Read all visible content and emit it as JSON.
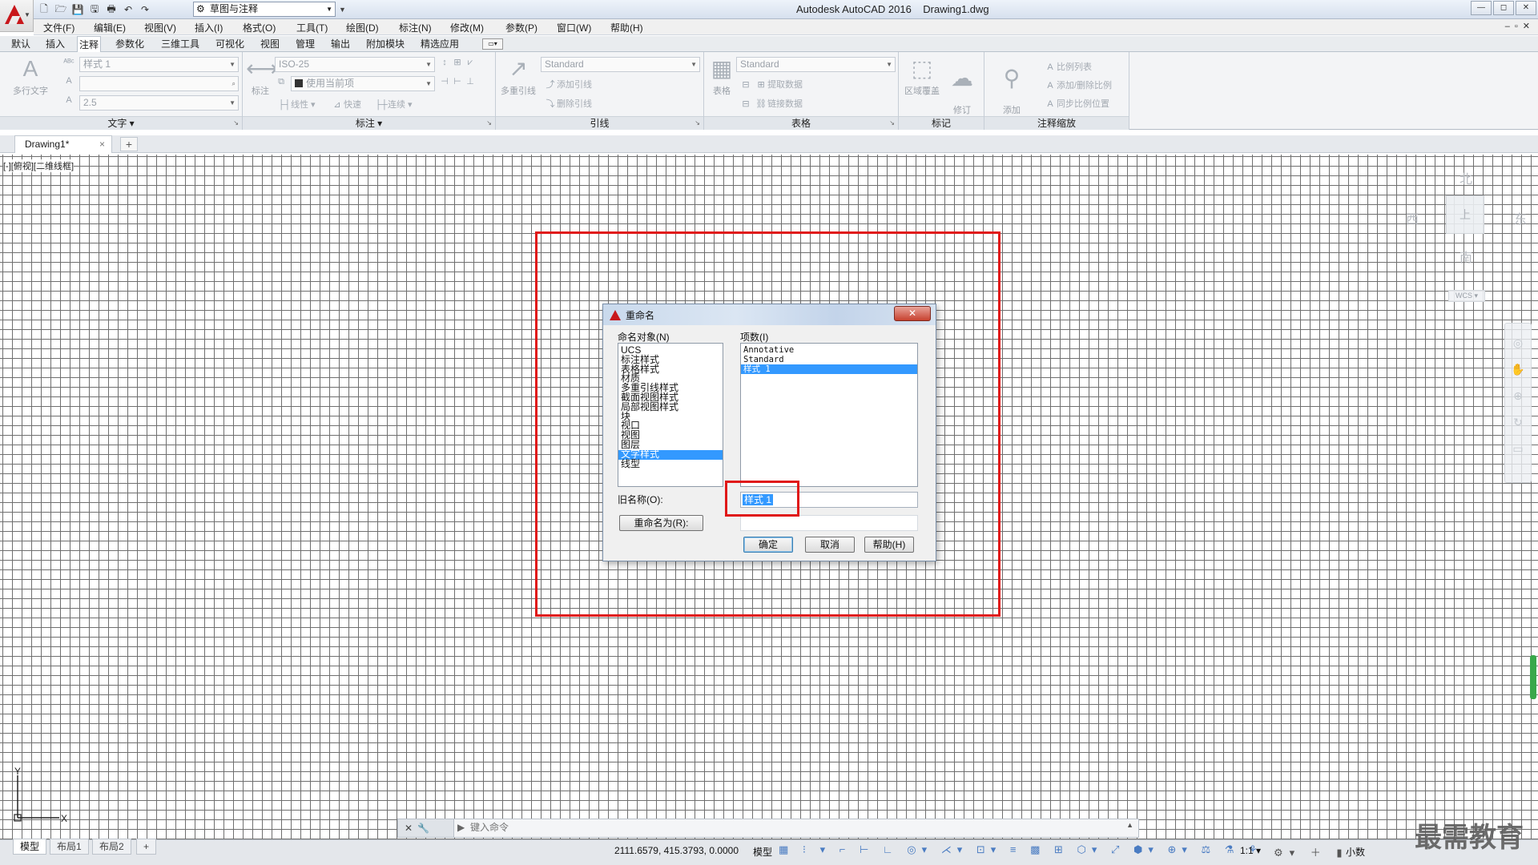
{
  "app": {
    "title": "Autodesk AutoCAD 2016    Drawing1.dwg",
    "workspace": "草图与注释",
    "window_controls": [
      "—",
      "◻",
      "✕"
    ],
    "doc_controls": "–▫✕"
  },
  "menubar": {
    "items": [
      "文件(F)",
      "编辑(E)",
      "视图(V)",
      "插入(I)",
      "格式(O)",
      "工具(T)",
      "绘图(D)",
      "标注(N)",
      "修改(M)",
      "参数(P)",
      "窗口(W)",
      "帮助(H)"
    ]
  },
  "ribbon_tabs": [
    "默认",
    "插入",
    "注释",
    "参数化",
    "三维工具",
    "可视化",
    "视图",
    "管理",
    "输出",
    "附加模块",
    "精选应用"
  ],
  "active_ribbon_tab": "注释",
  "ribbon": {
    "text_panel": {
      "title": "文字",
      "big_tool": "多行文字",
      "style_combo": "样式 1",
      "height_combo": "2.5"
    },
    "dim_panel": {
      "title": "标注",
      "big_tool": "标注",
      "style_combo": "ISO-25",
      "layer_combo": "使用当前项",
      "linear": "线性",
      "quick": "快速",
      "continue": "连续"
    },
    "leader_panel": {
      "title": "引线",
      "big_tool": "多重引线",
      "style_combo": "Standard",
      "add": "添加引线",
      "remove": "删除引线"
    },
    "table_panel": {
      "title": "表格",
      "big_tool": "表格",
      "style_combo": "Standard",
      "extract": "提取数据",
      "link": "链接数据"
    },
    "markup_panel": {
      "title": "标记",
      "wipeout": "区域覆盖",
      "revcloud": "修订\n云线"
    },
    "scale_panel": {
      "title": "注释缩放",
      "add_scale": "添加\n当前比例",
      "scale_list": "比例列表",
      "add_delete": "添加/删除比例",
      "sync": "同步比例位置"
    }
  },
  "file_tab": {
    "name": "Drawing1*",
    "close": "×",
    "new": "+"
  },
  "viewport": {
    "label": "[-][俯视][二维线框]"
  },
  "viewcube": {
    "north": "北",
    "south": "南",
    "east": "东",
    "west": "西",
    "face": "上",
    "wcs": "WCS ▾"
  },
  "dialog": {
    "title": "重命名",
    "close": "✕",
    "named_objects_label": "命名对象(N)",
    "named_objects": [
      "UCS",
      "标注样式",
      "表格样式",
      "材质",
      "多重引线样式",
      "截面视图样式",
      "局部视图样式",
      "块",
      "视口",
      "视图",
      "图层",
      "文字样式",
      "线型"
    ],
    "named_objects_selected": 11,
    "items_label": "项数(I)",
    "items": [
      "Annotative",
      "Standard",
      "样式 1"
    ],
    "items_selected": 2,
    "old_name_label": "旧名称(O):",
    "old_name_value": "样式 1",
    "rename_to_button": "重命名为(R):",
    "rename_to_value": "",
    "ok": "确定",
    "cancel": "取消",
    "help": "帮助(H)"
  },
  "cmdline": {
    "buttons": "✕🔧",
    "hint": "键入命令"
  },
  "layout_tabs": [
    "模型",
    "布局1",
    "布局2",
    "+"
  ],
  "status": {
    "coords": "2111.6579, 415.3793, 0.0000",
    "model": "模型",
    "scale": "1:1 ▾",
    "units": "小数"
  },
  "watermark": "最需教育",
  "colors": {
    "accent": "#3399ff",
    "highlight_red": "#e01818",
    "logo_red": "#c8171b"
  }
}
